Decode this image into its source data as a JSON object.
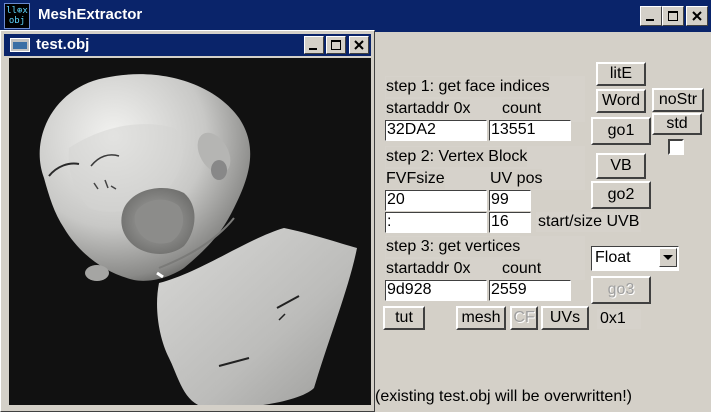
{
  "app": {
    "icon_text": "ll⊕x obj",
    "title": "MeshExtractor"
  },
  "window_controls": {
    "minimize": "_",
    "maximize": "□",
    "close": "✕"
  },
  "inner_window": {
    "title": "test.obj"
  },
  "step1": {
    "heading": "step 1: get face indices",
    "startaddr_label": "startaddr 0x",
    "count_label": "count",
    "startaddr_value": "32DA2",
    "count_value": "13551"
  },
  "step2": {
    "heading": "step 2: Vertex Block",
    "fvfsize_label": "FVFsize",
    "uvpos_label": "UV pos",
    "fvfsize_value": "20",
    "uvpos_value": "99",
    "uvb_start_value": ":",
    "uvb_size_value": "16",
    "uvb_label": "start/size UVB"
  },
  "step3": {
    "heading": "step 3: get vertices",
    "startaddr_label": "startaddr 0x",
    "count_label": "count",
    "startaddr_value": "9d928",
    "count_value": "2559"
  },
  "buttons": {
    "litE": "litE",
    "word": "Word",
    "nostr": "noStr",
    "std": "std",
    "go1": "go1",
    "vb": "VB",
    "go2": "go2",
    "go3": "go3",
    "tut": "tut",
    "mesh": "mesh",
    "cf": "CF",
    "uvs": "UVs"
  },
  "format_select": {
    "selected": "Float"
  },
  "scale_label": "0x1",
  "status": "(existing test.obj will be overwritten!)"
}
